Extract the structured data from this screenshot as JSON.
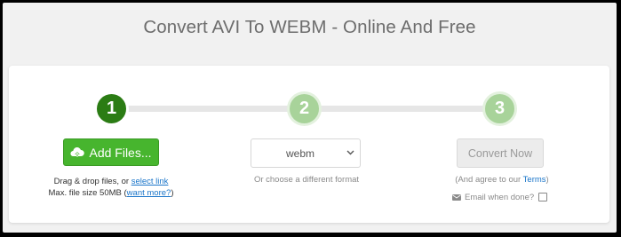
{
  "title": "Convert AVI To WEBM - Online And Free",
  "steps": [
    "1",
    "2",
    "3"
  ],
  "upload": {
    "button_label": "Add Files...",
    "drag_text": "Drag & drop files, or ",
    "select_link": "select link",
    "max_size_text": "Max. file size 50MB (",
    "want_more_link": "want more?",
    "close_paren": ")"
  },
  "format": {
    "selected": "webm",
    "hint": "Or choose a different format"
  },
  "convert": {
    "button_label": "Convert Now",
    "agree_prefix": "(And agree to our ",
    "terms_link": "Terms",
    "agree_suffix": ")",
    "email_label": "Email when done?"
  },
  "colors": {
    "active_step": "#2b7c14",
    "inactive_step": "#a8d39a",
    "add_button": "#47b52e",
    "link": "#1a75c9"
  },
  "icons": {
    "upload": "cloud-upload-icon",
    "select_chevron": "chevron-down-icon",
    "email": "envelope-icon"
  }
}
